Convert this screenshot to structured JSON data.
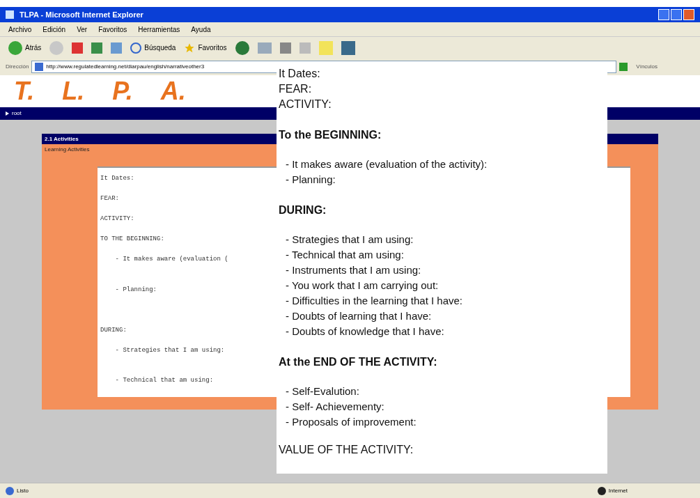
{
  "window": {
    "title": "TLPA - Microsoft Internet Explorer"
  },
  "menu": [
    "Archivo",
    "Edición",
    "Ver",
    "Favoritos",
    "Herramientas",
    "Ayuda"
  ],
  "toolbar": {
    "back": "Atrás",
    "search": "Búsqueda",
    "favorites": "Favoritos"
  },
  "address": {
    "label": "Dirección",
    "url": "http://www.regulatedlearning.net/diarpau/english/narrativeother3",
    "links": "Vínculos"
  },
  "page": {
    "logo": [
      "T.",
      "L.",
      "P.",
      "A."
    ],
    "nav": "root",
    "panel_title": "2.1 Activities",
    "panel_subtitle": "Learning Activities",
    "text_area": "It Dates:\n\nFEAR:\n\nACTIVITY:\n\nTO THE BEGINNING:\n\n    - It makes aware (evaluation (\n\n\n    - Planning:\n\n\n\nDURING:\n\n    - Strategies that I am using:\n\n\n    - Technical that am using:"
  },
  "popup": {
    "top": [
      "It Dates:",
      "FEAR:",
      "ACTIVITY:"
    ],
    "sections": [
      {
        "heading": "To the BEGINNING:",
        "items": [
          "- It makes aware (evaluation of the activity):",
          "- Planning:"
        ]
      },
      {
        "heading": "DURING:",
        "items": [
          "- Strategies that I am using:",
          "- Technical that am using:",
          "- Instruments that I am using:",
          "- You work that I am carrying out:",
          "- Difficulties in the learning that I have:",
          "- Doubts of learning that I have:",
          "- Doubts of knowledge that I have:"
        ]
      },
      {
        "heading": "At the END OF THE ACTIVITY:",
        "items": [
          "- Self-Evalution:",
          "- Self- Achievementy:",
          "- Proposals of improvement:"
        ]
      }
    ],
    "bottom": "VALUE OF THE ACTIVITY:"
  },
  "status": {
    "text": "Listo",
    "zone": "Internet"
  }
}
